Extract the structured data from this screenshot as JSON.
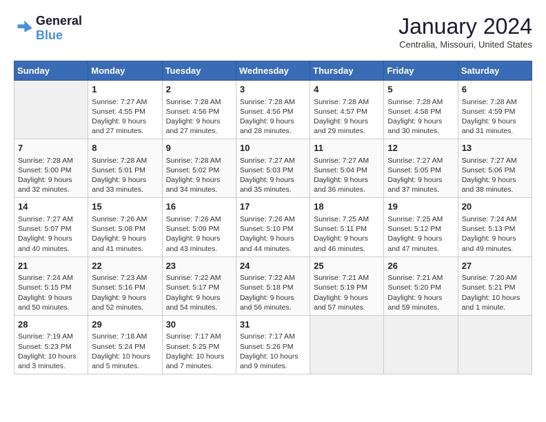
{
  "header": {
    "logo_line1": "General",
    "logo_line2": "Blue",
    "title": "January 2024",
    "subtitle": "Centralia, Missouri, United States"
  },
  "columns": [
    "Sunday",
    "Monday",
    "Tuesday",
    "Wednesday",
    "Thursday",
    "Friday",
    "Saturday"
  ],
  "weeks": [
    [
      {
        "day": "",
        "empty": true
      },
      {
        "day": "1",
        "sunrise": "7:27 AM",
        "sunset": "4:55 PM",
        "daylight": "9 hours and 27 minutes."
      },
      {
        "day": "2",
        "sunrise": "7:28 AM",
        "sunset": "4:56 PM",
        "daylight": "9 hours and 27 minutes."
      },
      {
        "day": "3",
        "sunrise": "7:28 AM",
        "sunset": "4:56 PM",
        "daylight": "9 hours and 28 minutes."
      },
      {
        "day": "4",
        "sunrise": "7:28 AM",
        "sunset": "4:57 PM",
        "daylight": "9 hours and 29 minutes."
      },
      {
        "day": "5",
        "sunrise": "7:28 AM",
        "sunset": "4:58 PM",
        "daylight": "9 hours and 30 minutes."
      },
      {
        "day": "6",
        "sunrise": "7:28 AM",
        "sunset": "4:59 PM",
        "daylight": "9 hours and 31 minutes."
      }
    ],
    [
      {
        "day": "7",
        "sunrise": "7:28 AM",
        "sunset": "5:00 PM",
        "daylight": "9 hours and 32 minutes."
      },
      {
        "day": "8",
        "sunrise": "7:28 AM",
        "sunset": "5:01 PM",
        "daylight": "9 hours and 33 minutes."
      },
      {
        "day": "9",
        "sunrise": "7:28 AM",
        "sunset": "5:02 PM",
        "daylight": "9 hours and 34 minutes."
      },
      {
        "day": "10",
        "sunrise": "7:27 AM",
        "sunset": "5:03 PM",
        "daylight": "9 hours and 35 minutes."
      },
      {
        "day": "11",
        "sunrise": "7:27 AM",
        "sunset": "5:04 PM",
        "daylight": "9 hours and 36 minutes."
      },
      {
        "day": "12",
        "sunrise": "7:27 AM",
        "sunset": "5:05 PM",
        "daylight": "9 hours and 37 minutes."
      },
      {
        "day": "13",
        "sunrise": "7:27 AM",
        "sunset": "5:06 PM",
        "daylight": "9 hours and 38 minutes."
      }
    ],
    [
      {
        "day": "14",
        "sunrise": "7:27 AM",
        "sunset": "5:07 PM",
        "daylight": "9 hours and 40 minutes."
      },
      {
        "day": "15",
        "sunrise": "7:26 AM",
        "sunset": "5:08 PM",
        "daylight": "9 hours and 41 minutes."
      },
      {
        "day": "16",
        "sunrise": "7:26 AM",
        "sunset": "5:09 PM",
        "daylight": "9 hours and 43 minutes."
      },
      {
        "day": "17",
        "sunrise": "7:26 AM",
        "sunset": "5:10 PM",
        "daylight": "9 hours and 44 minutes."
      },
      {
        "day": "18",
        "sunrise": "7:25 AM",
        "sunset": "5:11 PM",
        "daylight": "9 hours and 46 minutes."
      },
      {
        "day": "19",
        "sunrise": "7:25 AM",
        "sunset": "5:12 PM",
        "daylight": "9 hours and 47 minutes."
      },
      {
        "day": "20",
        "sunrise": "7:24 AM",
        "sunset": "5:13 PM",
        "daylight": "9 hours and 49 minutes."
      }
    ],
    [
      {
        "day": "21",
        "sunrise": "7:24 AM",
        "sunset": "5:15 PM",
        "daylight": "9 hours and 50 minutes."
      },
      {
        "day": "22",
        "sunrise": "7:23 AM",
        "sunset": "5:16 PM",
        "daylight": "9 hours and 52 minutes."
      },
      {
        "day": "23",
        "sunrise": "7:22 AM",
        "sunset": "5:17 PM",
        "daylight": "9 hours and 54 minutes."
      },
      {
        "day": "24",
        "sunrise": "7:22 AM",
        "sunset": "5:18 PM",
        "daylight": "9 hours and 56 minutes."
      },
      {
        "day": "25",
        "sunrise": "7:21 AM",
        "sunset": "5:19 PM",
        "daylight": "9 hours and 57 minutes."
      },
      {
        "day": "26",
        "sunrise": "7:21 AM",
        "sunset": "5:20 PM",
        "daylight": "9 hours and 59 minutes."
      },
      {
        "day": "27",
        "sunrise": "7:20 AM",
        "sunset": "5:21 PM",
        "daylight": "10 hours and 1 minute."
      }
    ],
    [
      {
        "day": "28",
        "sunrise": "7:19 AM",
        "sunset": "5:23 PM",
        "daylight": "10 hours and 3 minutes."
      },
      {
        "day": "29",
        "sunrise": "7:18 AM",
        "sunset": "5:24 PM",
        "daylight": "10 hours and 5 minutes."
      },
      {
        "day": "30",
        "sunrise": "7:17 AM",
        "sunset": "5:25 PM",
        "daylight": "10 hours and 7 minutes."
      },
      {
        "day": "31",
        "sunrise": "7:17 AM",
        "sunset": "5:26 PM",
        "daylight": "10 hours and 9 minutes."
      },
      {
        "day": "",
        "empty": true
      },
      {
        "day": "",
        "empty": true
      },
      {
        "day": "",
        "empty": true
      }
    ]
  ]
}
